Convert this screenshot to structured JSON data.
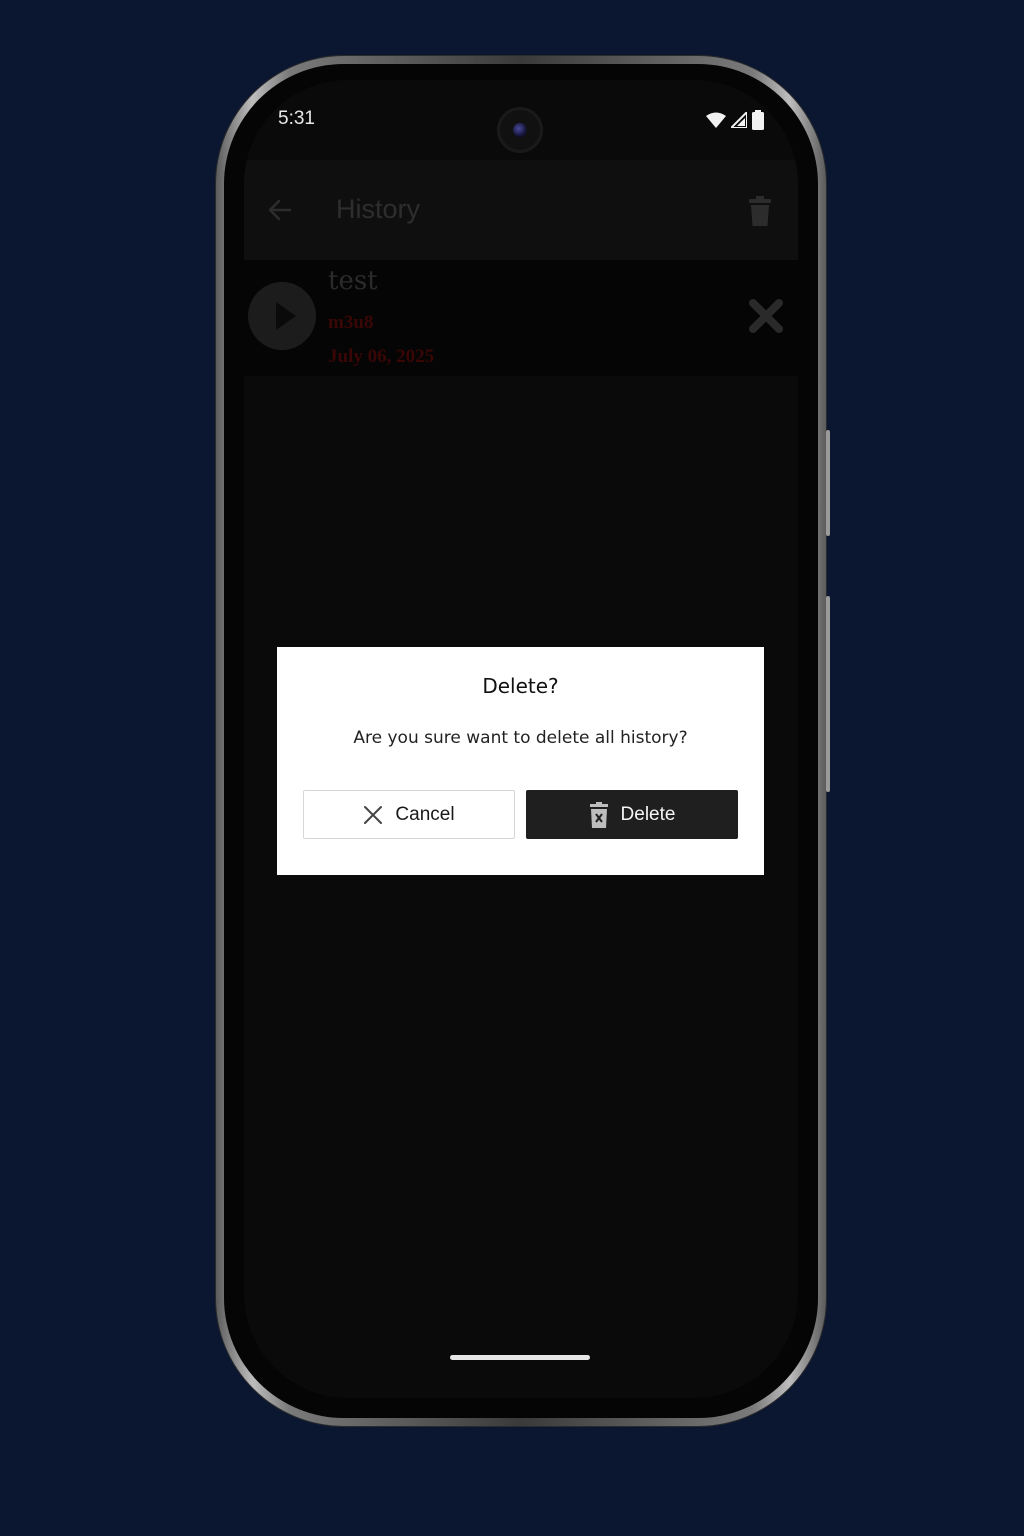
{
  "status_bar": {
    "time": "5:31",
    "icons": [
      "wifi-icon",
      "signal-icon",
      "battery-icon"
    ]
  },
  "app_bar": {
    "title": "History",
    "back_icon": "arrow-left-icon",
    "action_icon": "trash-icon"
  },
  "history": {
    "items": [
      {
        "title": "test",
        "format": "m3u8",
        "date": "July 06, 2025"
      }
    ]
  },
  "dialog": {
    "title": "Delete?",
    "message": "Are you sure want to delete all history?",
    "cancel_label": "Cancel",
    "delete_label": "Delete"
  },
  "colors": {
    "background": "#0b1730",
    "screen": "#0a0a0a",
    "dialog": "#ffffff",
    "delete_button": "#1f1f1f",
    "accent_red_dim": "#3a0606"
  }
}
